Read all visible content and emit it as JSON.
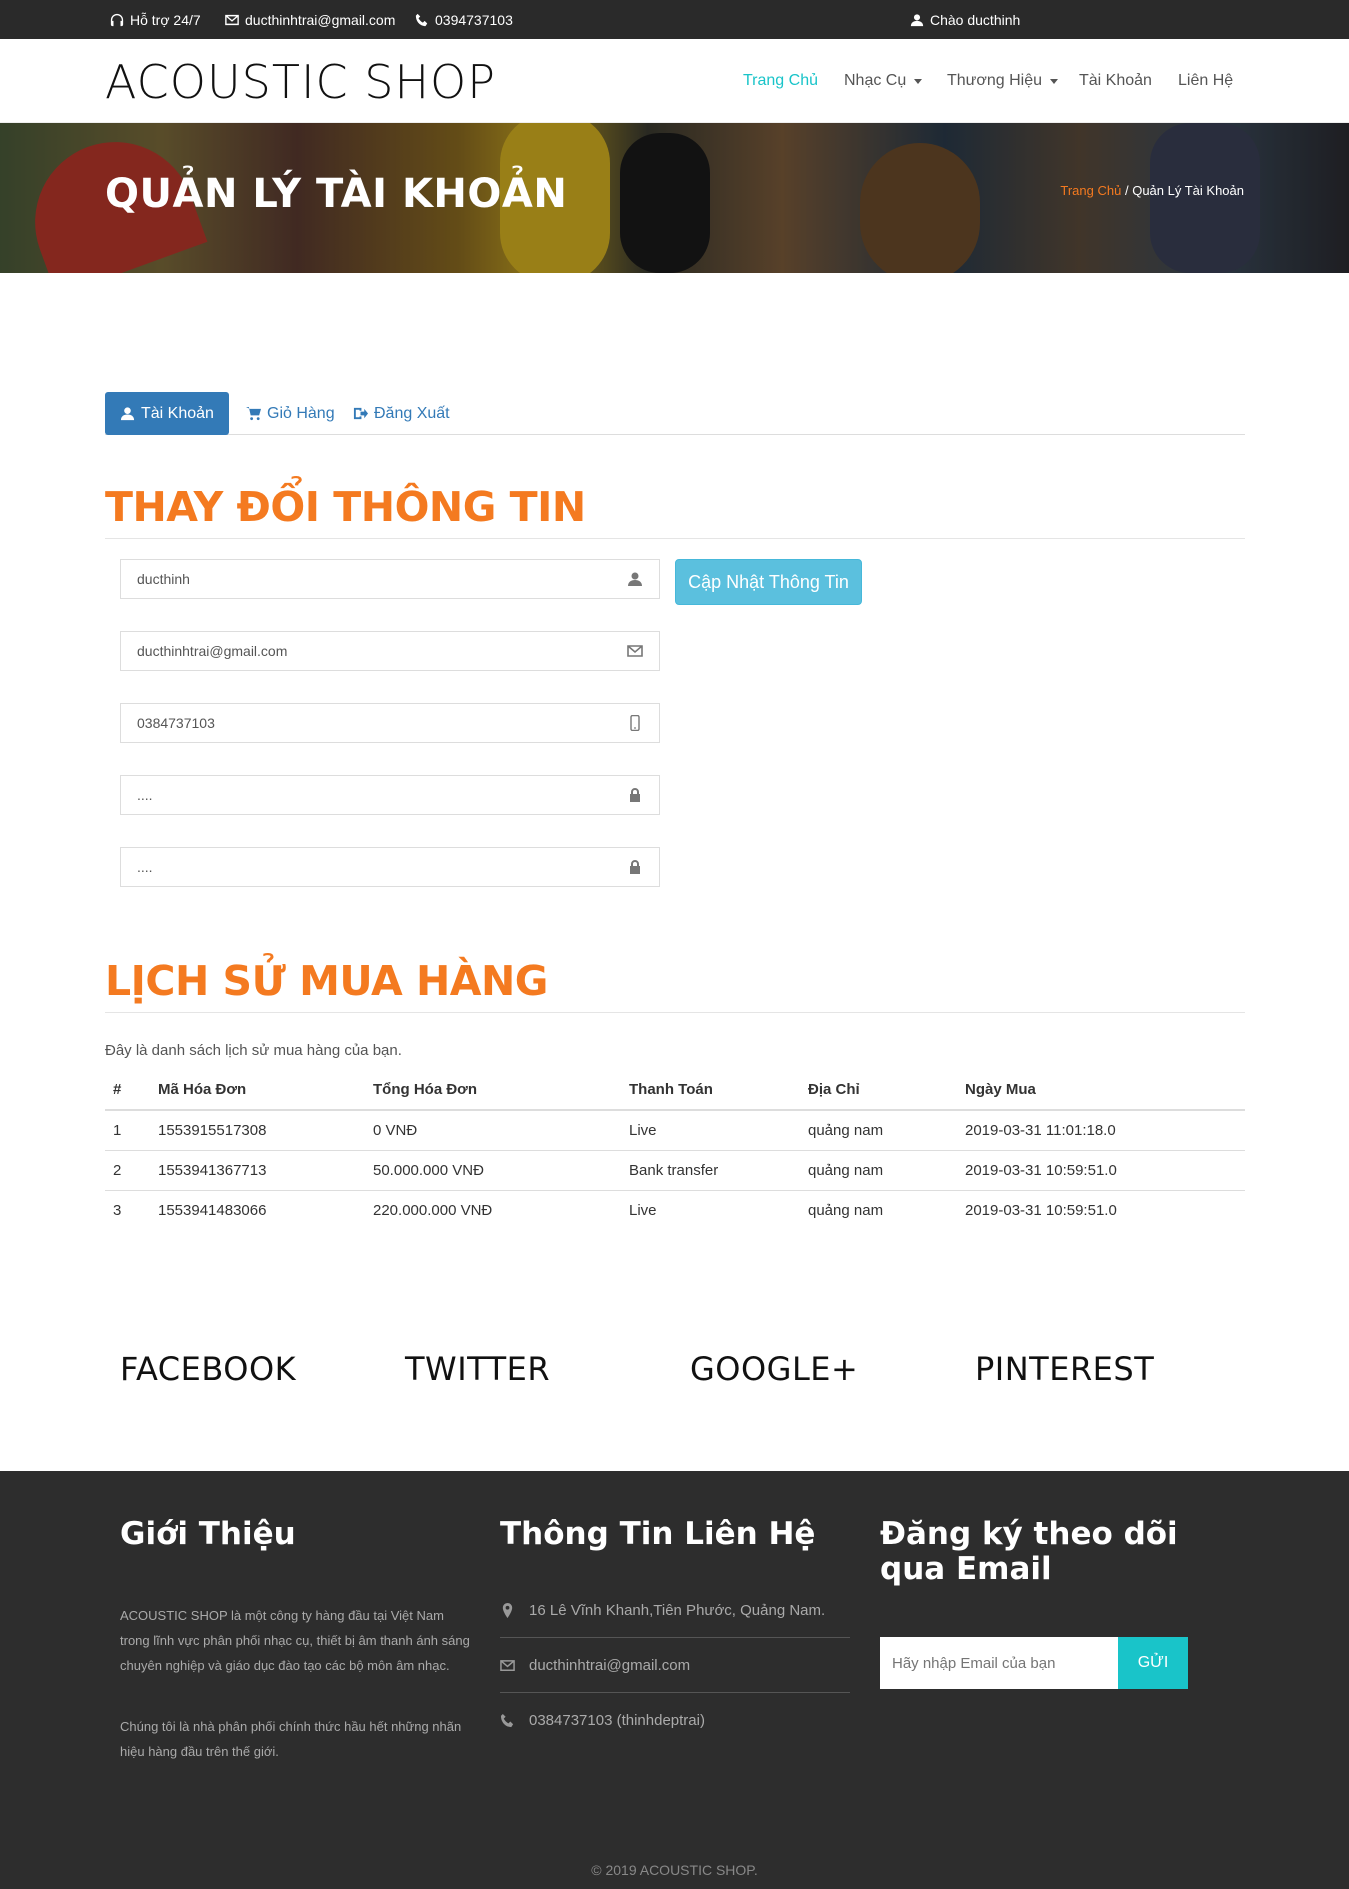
{
  "topbar": {
    "support": "Hỗ trợ 24/7",
    "email": "ducthinhtrai@gmail.com",
    "phone": "0394737103",
    "greeting": "Chào ducthinh"
  },
  "header": {
    "logo": "ACOUSTIC SHOP",
    "nav": {
      "home": "Trang Chủ",
      "instruments": "Nhạc Cụ",
      "brands": "Thương Hiệu",
      "account": "Tài Khoản",
      "contact": "Liên Hệ"
    }
  },
  "banner": {
    "title": "QUẢN LÝ TÀI KHOẢN",
    "breadcrumb_home": "Trang Chủ",
    "breadcrumb_sep": "/",
    "breadcrumb_current": "Quản Lý Tài Khoản"
  },
  "tabs": {
    "account": "Tài Khoản",
    "cart": "Giỏ Hàng",
    "logout": "Đăng Xuất"
  },
  "profile": {
    "title": "THAY ĐỔI THÔNG TIN",
    "username": "ducthinh",
    "email": "ducthinhtrai@gmail.com",
    "phone": "0384737103",
    "password": "....",
    "confirm_password": "....",
    "update_button": "Cập Nhật Thông Tin"
  },
  "history": {
    "title": "LỊCH SỬ MUA HÀNG",
    "intro": "Đây là danh sách lịch sử mua hàng của bạn.",
    "headers": [
      "#",
      "Mã Hóa Đơn",
      "Tổng Hóa Đơn",
      "Thanh Toán",
      "Địa Chỉ",
      "Ngày Mua"
    ],
    "rows": [
      [
        "1",
        "1553915517308",
        "0 VNĐ",
        "Live",
        "quảng nam",
        "2019-03-31 11:01:18.0"
      ],
      [
        "2",
        "1553941367713",
        "50.000.000 VNĐ",
        "Bank transfer",
        "quảng nam",
        "2019-03-31 10:59:51.0"
      ],
      [
        "3",
        "1553941483066",
        "220.000.000 VNĐ",
        "Live",
        "quảng nam",
        "2019-03-31 10:59:51.0"
      ]
    ]
  },
  "social": {
    "facebook": "FACEBOOK",
    "twitter": "TWITTER",
    "google": "GOOGLE+",
    "pinterest": "PINTEREST"
  },
  "footer": {
    "about_title": "Giới Thiệu",
    "about_p1": "ACOUSTIC SHOP là một công ty hàng đầu tại Việt Nam trong lĩnh vực phân phối nhạc cụ, thiết bị âm thanh ánh sáng chuyên nghiệp và giáo dục đào tạo các bộ môn âm nhạc.",
    "about_p2": "Chúng tôi là nhà phân phối chính thức hầu hết những nhãn hiệu hàng đầu trên thế giới.",
    "contact_title": "Thông Tin Liên Hệ",
    "address": "16 Lê Vĩnh Khanh,Tiên Phước, Quảng Nam.",
    "email": "ducthinhtrai@gmail.com",
    "phone": "0384737103 (thinhdeptrai)",
    "subscribe_title": "Đăng ký theo dõi qua Email",
    "subscribe_placeholder": "Hãy nhập Email của bạn",
    "subscribe_button": "GỬI",
    "copyright": "© 2019 ACOUSTIC SHOP."
  },
  "colors": {
    "accent_orange": "#f47a20",
    "accent_teal": "#19c4c9",
    "primary_blue": "#337ab7",
    "info_button": "#5bc0de",
    "dark_bg": "#2d2d2d"
  }
}
